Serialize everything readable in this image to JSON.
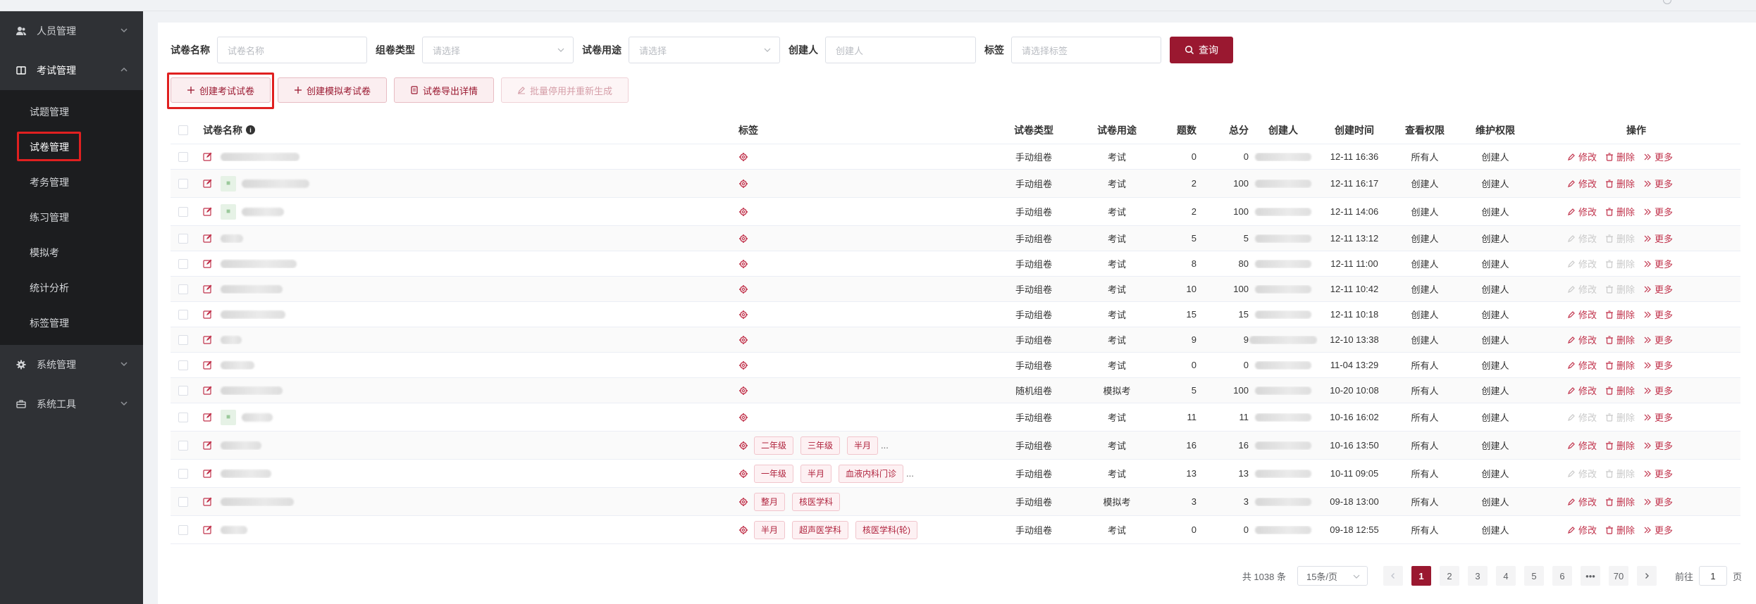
{
  "sidebar": {
    "groups": [
      {
        "label": "人员管理",
        "icon": "user-icon"
      },
      {
        "label": "考试管理",
        "icon": "book-icon"
      },
      {
        "label": "系统管理",
        "icon": "gear-icon"
      },
      {
        "label": "系统工具",
        "icon": "toolbox-icon"
      }
    ],
    "exam_items": [
      "试题管理",
      "试卷管理",
      "考务管理",
      "练习管理",
      "模拟考",
      "统计分析",
      "标签管理"
    ]
  },
  "filters": {
    "name_label": "试卷名称",
    "name_placeholder": "试卷名称",
    "type_label": "组卷类型",
    "type_placeholder": "请选择",
    "use_label": "试卷用途",
    "use_placeholder": "请选择",
    "creator_label": "创建人",
    "creator_placeholder": "创建人",
    "tag_label": "标签",
    "tag_placeholder": "请选择标签",
    "query_label": "查询"
  },
  "actions": {
    "create_exam": "创建考试试卷",
    "create_mock": "创建模拟考试卷",
    "export": "试卷导出详情",
    "batch": "批量停用并重新生成"
  },
  "table": {
    "headers": {
      "name": "试卷名称",
      "tags": "标签",
      "type": "试卷类型",
      "use": "试卷用途",
      "count": "题数",
      "score": "总分",
      "creator": "创建人",
      "time": "创建时间",
      "view": "查看权限",
      "maint": "维护权限",
      "ops": "操作"
    },
    "op_labels": {
      "modify": "修改",
      "delete": "删除",
      "more": "更多"
    },
    "rows": [
      {
        "type": "手动组卷",
        "use": "考试",
        "count": "0",
        "score": "0",
        "time": "12-11 16:36",
        "view": "所有人",
        "maint": "创建人",
        "tags": [],
        "ellipsis": ""
      },
      {
        "type": "手动组卷",
        "use": "考试",
        "count": "2",
        "score": "100",
        "time": "12-11 16:17",
        "view": "创建人",
        "maint": "创建人",
        "tags": [],
        "ellipsis": ""
      },
      {
        "type": "手动组卷",
        "use": "考试",
        "count": "2",
        "score": "100",
        "time": "12-11 14:06",
        "view": "创建人",
        "maint": "创建人",
        "tags": [],
        "ellipsis": ""
      },
      {
        "type": "手动组卷",
        "use": "考试",
        "count": "5",
        "score": "5",
        "time": "12-11 13:12",
        "view": "创建人",
        "maint": "创建人",
        "tags": [],
        "ellipsis": ""
      },
      {
        "type": "手动组卷",
        "use": "考试",
        "count": "8",
        "score": "80",
        "time": "12-11 11:00",
        "view": "创建人",
        "maint": "创建人",
        "tags": [],
        "ellipsis": ""
      },
      {
        "type": "手动组卷",
        "use": "考试",
        "count": "10",
        "score": "100",
        "time": "12-11 10:42",
        "view": "创建人",
        "maint": "创建人",
        "tags": [],
        "ellipsis": ""
      },
      {
        "type": "手动组卷",
        "use": "考试",
        "count": "15",
        "score": "15",
        "time": "12-11 10:18",
        "view": "创建人",
        "maint": "创建人",
        "tags": [],
        "ellipsis": ""
      },
      {
        "type": "手动组卷",
        "use": "考试",
        "count": "9",
        "score": "9",
        "time": "12-10 13:38",
        "view": "创建人",
        "maint": "创建人",
        "tags": [],
        "ellipsis": ""
      },
      {
        "type": "手动组卷",
        "use": "考试",
        "count": "0",
        "score": "0",
        "time": "11-04 13:29",
        "view": "所有人",
        "maint": "创建人",
        "tags": [],
        "ellipsis": ""
      },
      {
        "type": "随机组卷",
        "use": "模拟考",
        "count": "5",
        "score": "100",
        "time": "10-20 10:08",
        "view": "所有人",
        "maint": "创建人",
        "tags": [],
        "ellipsis": ""
      },
      {
        "type": "手动组卷",
        "use": "考试",
        "count": "11",
        "score": "11",
        "time": "10-16 16:02",
        "view": "所有人",
        "maint": "创建人",
        "tags": [],
        "ellipsis": ""
      },
      {
        "type": "手动组卷",
        "use": "考试",
        "count": "16",
        "score": "16",
        "time": "10-16 13:50",
        "view": "所有人",
        "maint": "创建人",
        "tags": [
          "二年级",
          "三年级",
          "半月"
        ],
        "ellipsis": "..."
      },
      {
        "type": "手动组卷",
        "use": "考试",
        "count": "13",
        "score": "13",
        "time": "10-11 09:05",
        "view": "所有人",
        "maint": "创建人",
        "tags": [
          "一年级",
          "半月",
          "血液内科门诊"
        ],
        "ellipsis": "..."
      },
      {
        "type": "手动组卷",
        "use": "模拟考",
        "count": "3",
        "score": "3",
        "time": "09-18 13:00",
        "view": "所有人",
        "maint": "创建人",
        "tags": [
          "整月",
          "核医学科"
        ],
        "ellipsis": ""
      },
      {
        "type": "手动组卷",
        "use": "考试",
        "count": "0",
        "score": "0",
        "time": "09-18 12:55",
        "view": "所有人",
        "maint": "创建人",
        "tags": [
          "半月",
          "超声医学科",
          "核医学科(轮)"
        ],
        "ellipsis": ""
      }
    ]
  },
  "pager": {
    "total": "共 1038 条",
    "size": "15条/页",
    "pages": [
      "1",
      "2",
      "3",
      "4",
      "5",
      "6",
      "•••",
      "70"
    ],
    "goto": "前往",
    "goto_value": "1",
    "unit": "页"
  }
}
